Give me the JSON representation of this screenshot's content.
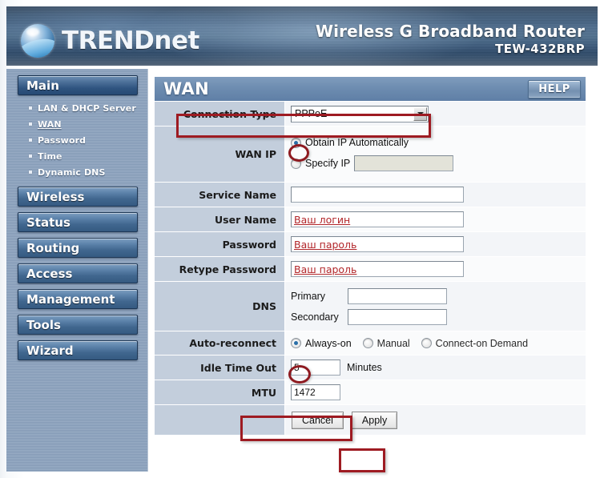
{
  "banner": {
    "brand": "TRENDnet",
    "brand_upper": "TRENDn",
    "brand_tail": "eT",
    "product_line1": "Wireless G Broadband Router",
    "product_line2": "TEW-432BRP",
    "logo_icon": "globe-wave-icon"
  },
  "sidebar": {
    "groups": [
      {
        "label": "Main",
        "active": true
      },
      {
        "label": "Wireless",
        "active": false
      },
      {
        "label": "Status",
        "active": false
      },
      {
        "label": "Routing",
        "active": false
      },
      {
        "label": "Access",
        "active": false
      },
      {
        "label": "Management",
        "active": false
      },
      {
        "label": "Tools",
        "active": false
      },
      {
        "label": "Wizard",
        "active": false
      }
    ],
    "main_submenu": [
      {
        "label": "LAN & DHCP Server",
        "active": false
      },
      {
        "label": "WAN",
        "active": true
      },
      {
        "label": "Password",
        "active": false
      },
      {
        "label": "Time",
        "active": false
      },
      {
        "label": "Dynamic DNS",
        "active": false
      }
    ]
  },
  "panel": {
    "title": "WAN",
    "help_label": "HELP"
  },
  "form": {
    "connection_type": {
      "label": "Connection Type",
      "value": "PPPoE",
      "options": [
        "PPPoE"
      ]
    },
    "wan_ip": {
      "label": "WAN IP",
      "obtain_label": "Obtain IP Automatically",
      "obtain_selected": true,
      "specify_label": "Specify IP",
      "specify_selected": false,
      "specify_value": ""
    },
    "service_name": {
      "label": "Service Name",
      "value": ""
    },
    "user_name": {
      "label": "User Name",
      "value": "Ваш логин"
    },
    "password": {
      "label": "Password",
      "value": "Ваш пароль"
    },
    "retype_password": {
      "label": "Retype Password",
      "value": "Ваш пароль"
    },
    "dns": {
      "label": "DNS",
      "primary_label": "Primary",
      "primary_value": "",
      "secondary_label": "Secondary",
      "secondary_value": ""
    },
    "auto_reconnect": {
      "label": "Auto-reconnect",
      "options": [
        {
          "label": "Always-on",
          "selected": true
        },
        {
          "label": "Manual",
          "selected": false
        },
        {
          "label": "Connect-on Demand",
          "selected": false
        }
      ]
    },
    "idle_timeout": {
      "label": "Idle Time Out",
      "value": "5",
      "unit": "Minutes"
    },
    "mtu": {
      "label": "MTU",
      "value": "1472"
    },
    "buttons": {
      "cancel": "Cancel",
      "apply": "Apply"
    }
  },
  "annotations": {
    "color": "#9e1b22",
    "items": [
      "connection-type-row-highlight",
      "obtain-ip-radio-highlight",
      "always-on-radio-highlight",
      "mtu-row-highlight",
      "apply-button-highlight"
    ]
  }
}
